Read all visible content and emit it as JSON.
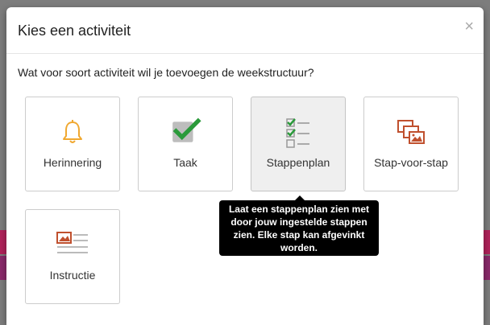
{
  "modal": {
    "title": "Kies een activiteit",
    "close_label": "×",
    "question": "Wat voor soort activiteit wil je toevoegen de weekstructuur?"
  },
  "tiles": [
    {
      "label": "Herinnering",
      "icon": "bell-icon"
    },
    {
      "label": "Taak",
      "icon": "checkbox-icon"
    },
    {
      "label": "Stappenplan",
      "icon": "checklist-icon"
    },
    {
      "label": "Stap-voor-stap",
      "icon": "image-stack-icon"
    },
    {
      "label": "Instructie",
      "icon": "image-text-icon"
    }
  ],
  "tooltip": {
    "text": "Laat een stappenplan zien met door jouw ingestelde stappen zien. Elke stap kan afgevinkt worden."
  },
  "colors": {
    "bell": "#f0a830",
    "check": "#2a9a3a",
    "image": "#c0502e",
    "gray": "#999999"
  }
}
